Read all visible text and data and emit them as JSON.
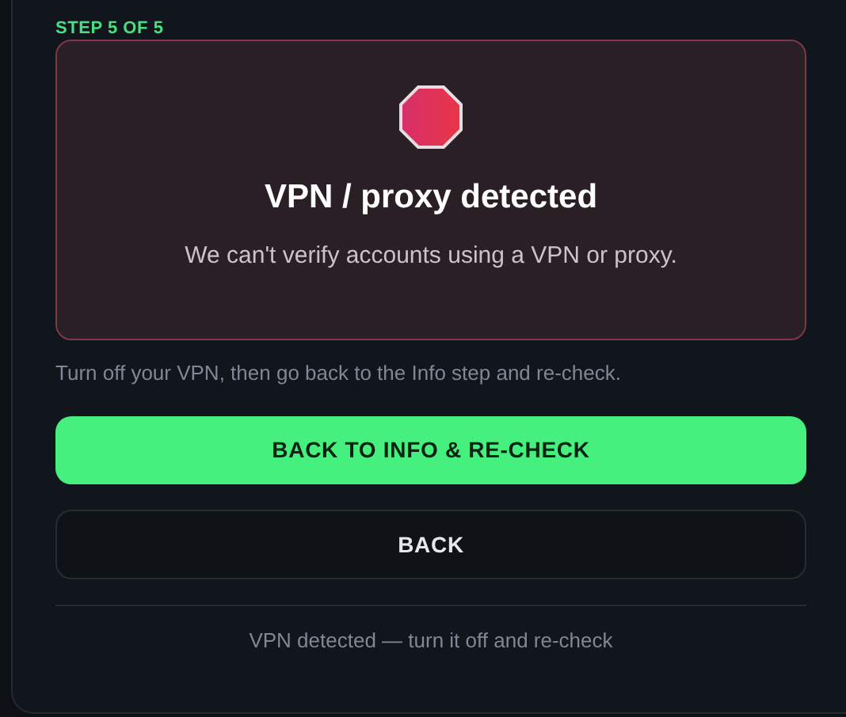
{
  "step_label": "STEP 5 OF 5",
  "alert": {
    "title": "VPN / proxy detected",
    "message": "We can't verify accounts using a VPN or proxy."
  },
  "hint": "Turn off your VPN, then go back to the Info step and re-check.",
  "buttons": [
    {
      "label": "BACK TO INFO & RE-CHECK",
      "kind": "primary"
    },
    {
      "label": "BACK",
      "kind": "secondary"
    }
  ],
  "footer": "VPN detected — turn it off and re-check"
}
